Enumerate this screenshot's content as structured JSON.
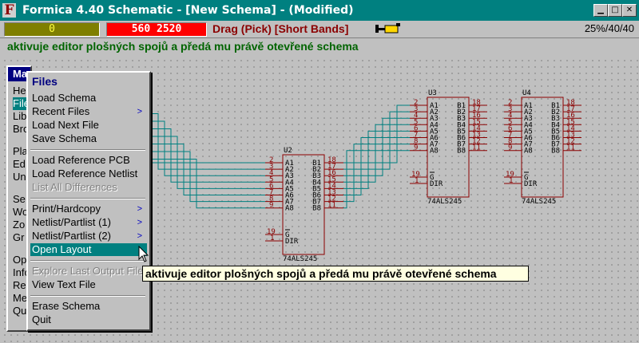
{
  "window": {
    "app_icon_letter": "F",
    "title": "Formica 4.40 Schematic - [New Schema] - (Modified)",
    "btn_minimize": "▁",
    "btn_maximize": "□",
    "btn_close": "✕"
  },
  "toolbar": {
    "zero_value": "0",
    "coords": "560  2520",
    "mode": "Drag  (Pick) [Short Bands]",
    "zoom": "25%/40/40",
    "mode_icon": "drag-tool-icon"
  },
  "hint": "aktivuje editor plošných spojů a předá mu právě otevřené schema",
  "main_menu": {
    "title": "Ma",
    "items": [
      "He",
      "File",
      "Lib",
      "Bro",
      "Pla",
      "Ed",
      "Un",
      "Se",
      "Wo",
      "Zo",
      "Gr",
      "Op",
      "Info",
      "Re",
      "Me",
      "Qu"
    ]
  },
  "files_menu": {
    "header": "Files",
    "items": [
      {
        "label": "Load Schema"
      },
      {
        "label": "Recent Files",
        "arrow": ">"
      },
      {
        "label": "Load Next File"
      },
      {
        "label": "Save Schema"
      },
      {
        "label": "Load Reference PCB"
      },
      {
        "label": "Load Reference Netlist"
      },
      {
        "label": "List All Differences"
      },
      {
        "label": "Print/Hardcopy",
        "arrow": ">"
      },
      {
        "label": "Netlist/Partlist  (1)",
        "arrow": ">"
      },
      {
        "label": "Netlist/Partlist  (2)",
        "arrow": ">"
      },
      {
        "label": "Open Layout"
      },
      {
        "label": "Explore Last Output File"
      },
      {
        "label": "View Text File"
      },
      {
        "label": "Erase Schema"
      },
      {
        "label": "Quit"
      }
    ]
  },
  "tooltip": "aktivuje editor plošných spojů a předá mu právě otevřené schema",
  "schematic": {
    "colors": {
      "wire": "#008080",
      "body": "#8b0000",
      "pin_number": "#8b0000",
      "pin_label": "#000"
    },
    "chips": [
      {
        "ref": "U2",
        "part": "74ALS245"
      },
      {
        "ref": "U3",
        "part": "74ALS245"
      },
      {
        "ref": "U4",
        "part": "74ALS245"
      }
    ],
    "left_pin_numbers": [
      "2",
      "3",
      "4",
      "5",
      "6",
      "7",
      "8",
      "9"
    ],
    "left_pin_labels": [
      "A1",
      "A2",
      "A3",
      "A4",
      "A5",
      "A6",
      "A7",
      "A8"
    ],
    "right_pin_labels": [
      "B1",
      "B2",
      "B3",
      "B4",
      "B5",
      "B6",
      "B7",
      "B8"
    ],
    "right_pin_numbers": [
      "18",
      "17",
      "16",
      "15",
      "14",
      "13",
      "12",
      "11"
    ],
    "ctrl_pin_numbers": [
      "19",
      "1"
    ],
    "ctrl_labels": [
      "G",
      "DIR"
    ]
  }
}
